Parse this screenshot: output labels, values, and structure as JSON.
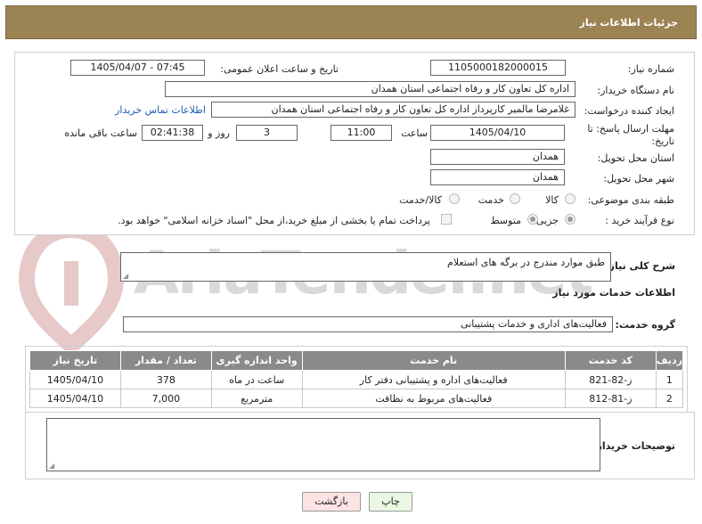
{
  "header": {
    "title": "جزئیات اطلاعات نیاز"
  },
  "watermark": {
    "text": "AriaTender.net"
  },
  "form": {
    "need_number": {
      "label": "شماره نیاز:",
      "value": "1105000182000015"
    },
    "announce_datetime": {
      "label": "تاریخ و ساعت اعلان عمومی:",
      "value": "1405/04/07 - 07:45"
    },
    "buyer_org": {
      "label": "نام دستگاه خریدار:",
      "value": "اداره کل تعاون  کار و رفاه اجتماعی استان همدان"
    },
    "requester": {
      "label": "ایجاد کننده درخواست:",
      "value": "غلامرضا مالمیر کارپرداز اداره کل تعاون  کار و رفاه اجتماعی استان همدان",
      "contact_link": "اطلاعات تماس خریدار"
    },
    "deadline": {
      "label_line1": "مهلت ارسال پاسخ: تا",
      "label_line2": "تاریخ:",
      "date": "1405/04/10",
      "time_label": "ساعت",
      "time": "11:00",
      "days": "3",
      "days_label": "روز و",
      "remaining": "02:41:38",
      "remaining_label": "ساعت باقی مانده"
    },
    "province": {
      "label": "استان محل تحویل:",
      "value": "همدان"
    },
    "city": {
      "label": "شهر محل تحویل:",
      "value": "همدان"
    },
    "category": {
      "label": "طبقه بندی موضوعی:",
      "options": [
        "کالا",
        "خدمت",
        "کالا/خدمت"
      ]
    },
    "purchase_type": {
      "label": "نوع فرآیند خرید :",
      "options": [
        "جزیی",
        "متوسط"
      ],
      "payment_note": "پرداخت تمام یا بخشی از مبلغ خرید،از محل \"اسناد خزانه اسلامی\" خواهد بود."
    }
  },
  "summary": {
    "label": "شرح کلی نیاز:",
    "value": "طبق موارد مندرج در برگه های استعلام"
  },
  "services_title": "اطلاعات خدمات مورد نیاز",
  "service_group": {
    "label": "گروه خدمت:",
    "value": "فعالیت‌های اداری و خدمات پشتیبانی"
  },
  "table": {
    "headers": [
      "ردیف",
      "کد خدمت",
      "نام خدمت",
      "واحد اندازه گیری",
      "تعداد / مقدار",
      "تاریخ نیاز"
    ],
    "rows": [
      [
        "1",
        "ز-82-821",
        "فعالیت‌های اداره و پشتیبانی دفتر کار",
        "ساعت در ماه",
        "378",
        "1405/04/10"
      ],
      [
        "2",
        "ز-81-812",
        "فعالیت‌های مربوط به نظافت",
        "مترمربع",
        "7,000",
        "1405/04/10"
      ]
    ]
  },
  "buyer_notes": {
    "label": "توضیحات خریدار:",
    "value": ""
  },
  "buttons": {
    "print": "چاپ",
    "back": "بازگشت"
  }
}
